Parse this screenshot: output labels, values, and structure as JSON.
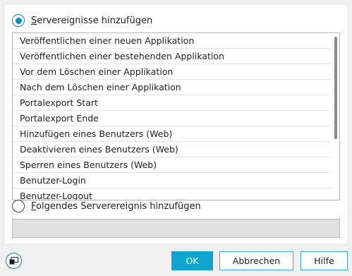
{
  "options": {
    "server_events": {
      "mnemonic": "S",
      "rest": "ervereignisse hinzufügen",
      "selected": true
    },
    "following_event": {
      "mnemonic": "F",
      "rest": "olgendes Serverereignis hinzufügen",
      "selected": false
    }
  },
  "event_list": [
    "Veröffentlichen einer neuen Applikation",
    "Veröffentlichen einer bestehenden Applikation",
    "Vor dem Löschen einer Applikation",
    "Nach dem Löschen einer Applikation",
    "Portalexport Start",
    "Portalexport Ende",
    "Hinzufügen eines Benutzers (Web)",
    "Deaktivieren eines Benutzers (Web)",
    "Sperren eines Benutzers (Web)",
    "Benutzer-Login",
    "Benutzer-Logout"
  ],
  "event_input": {
    "value": ""
  },
  "buttons": {
    "ok": "OK",
    "cancel": "Abbrechen",
    "help": "Hilfe"
  },
  "icons": {
    "bottom_left": "window-icon"
  },
  "colors": {
    "accent": "#0ea5cf",
    "radio_selected": "#0e8cc3",
    "button_border": "#3aa8d8"
  }
}
